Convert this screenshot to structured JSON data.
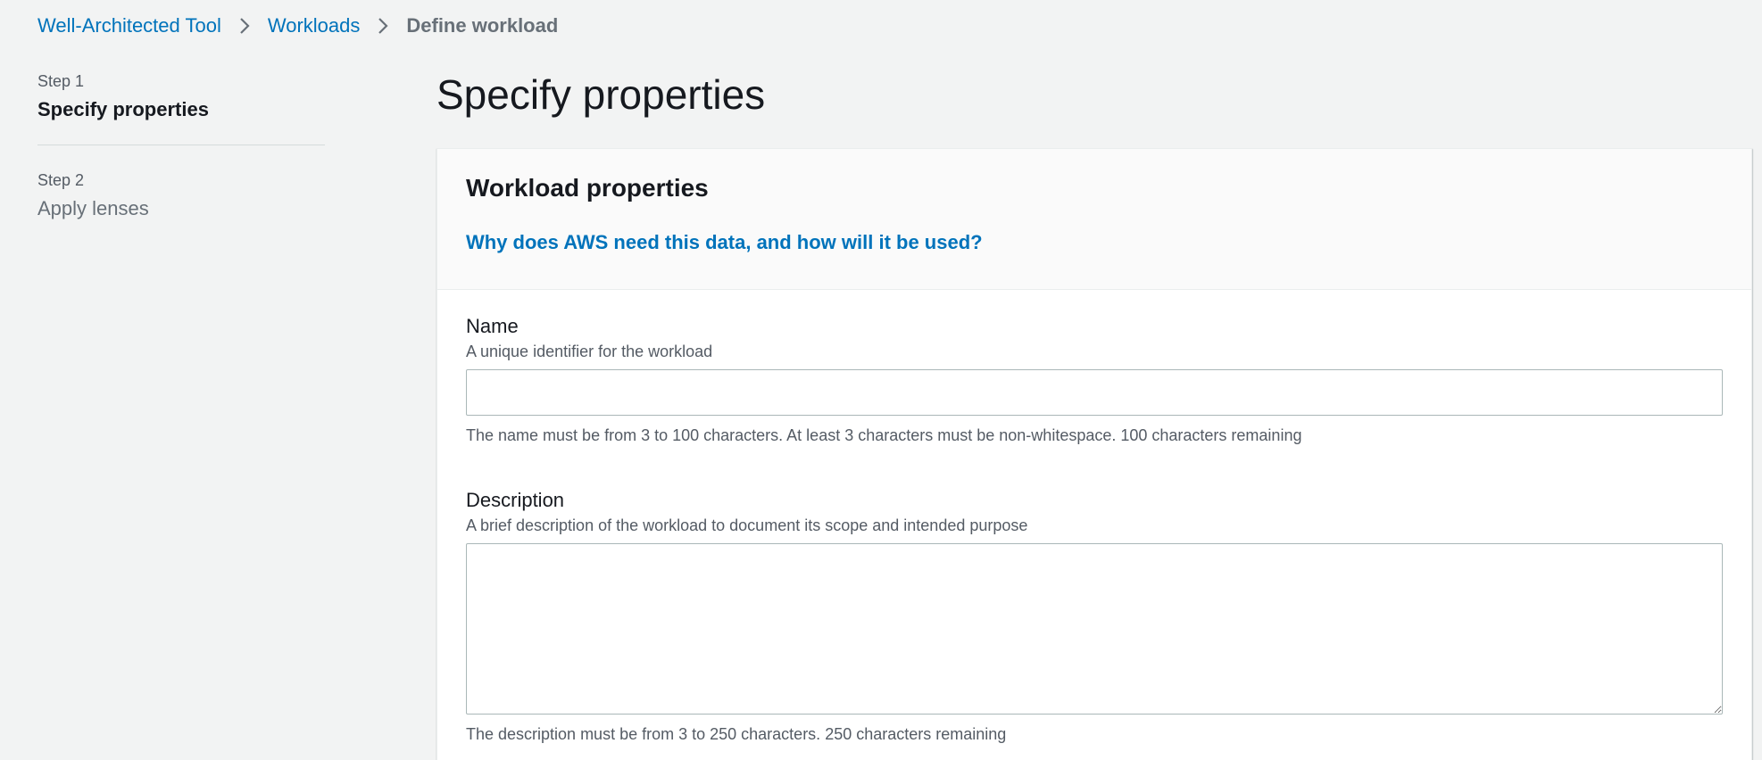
{
  "breadcrumb": {
    "items": [
      {
        "label": "Well-Architected Tool"
      },
      {
        "label": "Workloads"
      }
    ],
    "current": "Define workload"
  },
  "steps": [
    {
      "step_label": "Step 1",
      "title": "Specify properties",
      "active": true
    },
    {
      "step_label": "Step 2",
      "title": "Apply lenses",
      "active": false
    }
  ],
  "main": {
    "title": "Specify properties"
  },
  "panel": {
    "title": "Workload properties",
    "info_link": "Why does AWS need this data, and how will it be used?",
    "name_field": {
      "label": "Name",
      "description": "A unique identifier for the workload",
      "value": "",
      "constraint": "The name must be from 3 to 100 characters. At least 3 characters must be non-whitespace. 100 characters remaining"
    },
    "description_field": {
      "label": "Description",
      "description": "A brief description of the workload to document its scope and intended purpose",
      "value": "",
      "constraint": "The description must be from 3 to 250 characters. 250 characters remaining"
    }
  },
  "colors": {
    "link": "#0073bb",
    "background": "#f2f3f3",
    "text": "#16191f",
    "secondary_text": "#545b64"
  }
}
